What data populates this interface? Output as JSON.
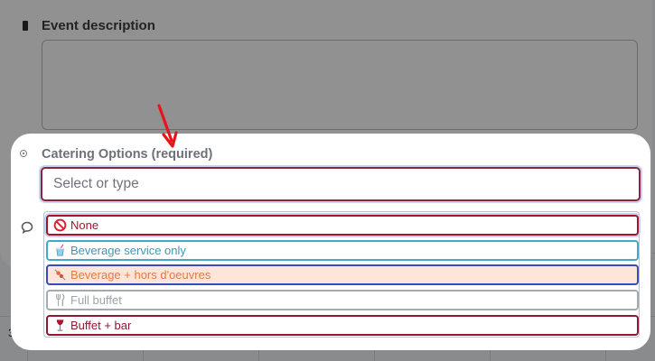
{
  "background": {
    "calendar_day": "31"
  },
  "description": {
    "label": "Event description",
    "value": ""
  },
  "catering": {
    "label": "Catering Options (required)",
    "placeholder": "Select or type",
    "options": [
      {
        "label": "None",
        "icon": "no-entry-icon",
        "color": "#a8122d"
      },
      {
        "label": "Beverage service only",
        "icon": "cup-with-straw-icon",
        "color": "#3e97b5"
      },
      {
        "label": "Beverage + hors d'oeuvres",
        "icon": "skewer-icon",
        "color": "#e67a40"
      },
      {
        "label": "Full buffet",
        "icon": "fork-knife-icon",
        "color": "#9ea2a8"
      },
      {
        "label": "Buffet + bar",
        "icon": "wine-glass-icon",
        "color": "#8f1833"
      }
    ]
  },
  "colors": {
    "focus_border": "#8a2540",
    "focus_ring": "#c6d2ee",
    "annotation_arrow": "#e8141b"
  }
}
